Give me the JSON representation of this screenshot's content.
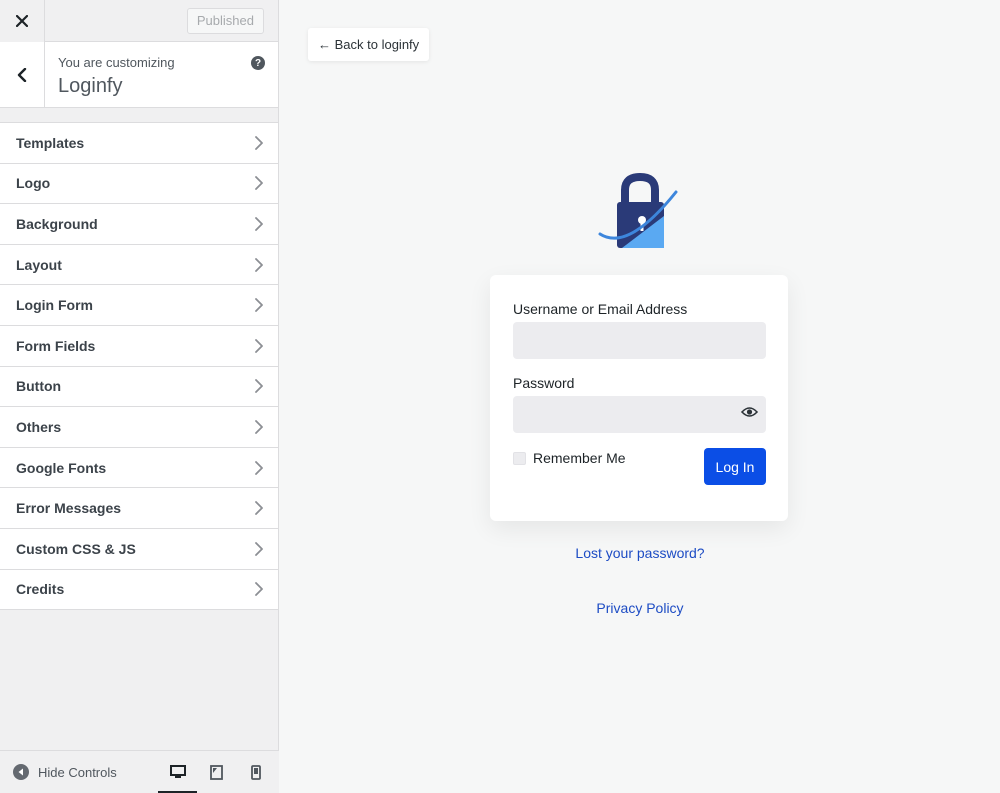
{
  "topbar": {
    "close_label": "✕",
    "published_label": "Published"
  },
  "info": {
    "customizing_label": "You are customizing",
    "site_title": "Loginfy",
    "help_label": "?"
  },
  "menu": {
    "items": [
      {
        "label": "Templates"
      },
      {
        "label": "Logo"
      },
      {
        "label": "Background"
      },
      {
        "label": "Layout"
      },
      {
        "label": "Login Form"
      },
      {
        "label": "Form Fields"
      },
      {
        "label": "Button"
      },
      {
        "label": "Others"
      },
      {
        "label": "Google Fonts"
      },
      {
        "label": "Error Messages"
      },
      {
        "label": "Custom CSS & JS"
      },
      {
        "label": "Credits"
      }
    ]
  },
  "footer": {
    "hide_controls_label": "Hide Controls",
    "devices": [
      "desktop",
      "tablet",
      "mobile"
    ],
    "active_device": "desktop"
  },
  "preview": {
    "back_link": "← Back to loginfy",
    "username_label": "Username or Email Address",
    "username_value": "",
    "password_label": "Password",
    "password_value": "",
    "remember_label": "Remember Me",
    "login_button": "Log In",
    "lost_password": "Lost your password?",
    "privacy_policy": "Privacy Policy"
  },
  "colors": {
    "primary_button": "#0b4ee6",
    "link": "#1d4cc4",
    "lock_body_dark": "#2a3a78",
    "lock_body_light": "#5aa9f2"
  }
}
